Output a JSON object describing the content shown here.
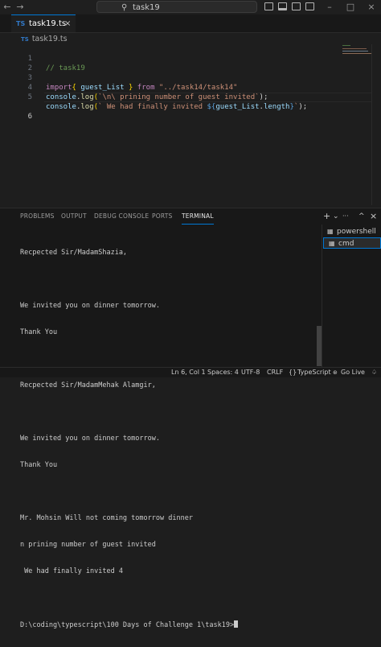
{
  "titlebar": {
    "back_icon": "arrow-left",
    "forward_icon": "arrow-right",
    "search_text": "task19",
    "search_icon": "search"
  },
  "tabs": [
    {
      "icon": "TS",
      "label": "task19.ts",
      "close": "×"
    }
  ],
  "breadcrumb": {
    "icon": "TS",
    "file": "task19.ts"
  },
  "editor": {
    "lines": [
      {
        "n": "1",
        "comment": "// task19"
      },
      {
        "n": "2"
      },
      {
        "n": "3",
        "kw": "import",
        "brace_open": "{",
        "name": " guest_List ",
        "brace_close": "}",
        "from": " from ",
        "path": "\"../task14/task14\""
      },
      {
        "n": "4",
        "obj": "console",
        "dot": ".",
        "fn": "log",
        "open": "(",
        "str": "`\\n\\ prining number of guest invited`",
        "close": ");"
      },
      {
        "n": "5",
        "obj": "console",
        "dot": ".",
        "fn": "log",
        "open": "(",
        "str": "` We had finally invited ",
        "tpl_open": "${",
        "var": "guest_List",
        "prop_dot": ".",
        "prop": "length",
        "tpl_close": "}",
        "str_end": "`",
        "close": ");"
      },
      {
        "n": "6"
      }
    ]
  },
  "panel": {
    "tabs": [
      "PROBLEMS",
      "OUTPUT",
      "DEBUG CONSOLE",
      "PORTS",
      "TERMINAL"
    ],
    "active_tab": "TERMINAL",
    "add_icon": "+",
    "dropdown_icon": "⌄",
    "more_icon": "···",
    "maximize_icon": "^",
    "close_icon": "×",
    "terminal_lines": [
      "Recpected Sir/MadamShazia,",
      "",
      "We invited you on dinner tomorrow.",
      "Thank You",
      "",
      "Recpected Sir/MadamMehak Alamgir,",
      "",
      "We invited you on dinner tomorrow.",
      "Thank You",
      "",
      "Mr. Mohsin Will not coming tomorrow dinner",
      "n prining number of guest invited",
      " We had finally invited 4",
      "",
      "D:\\coding\\typescript\\100 Days of Challenge 1\\task19>"
    ],
    "terminals": [
      {
        "label": "powershell",
        "icon": "terminal"
      },
      {
        "label": "cmd",
        "icon": "terminal"
      }
    ]
  },
  "statusbar": {
    "position": "Ln 6, Col 1",
    "spaces": "Spaces: 4",
    "encoding": "UTF-8",
    "eol": "CRLF",
    "lang_braces": "{}",
    "language": "TypeScript",
    "golive": "Go Live",
    "bell_icon": "bell"
  },
  "colors": {
    "accent": "#0078d4",
    "editor_bg": "#1e1e1e",
    "panel_bg": "#181818",
    "ts_blue": "#3178c6"
  }
}
